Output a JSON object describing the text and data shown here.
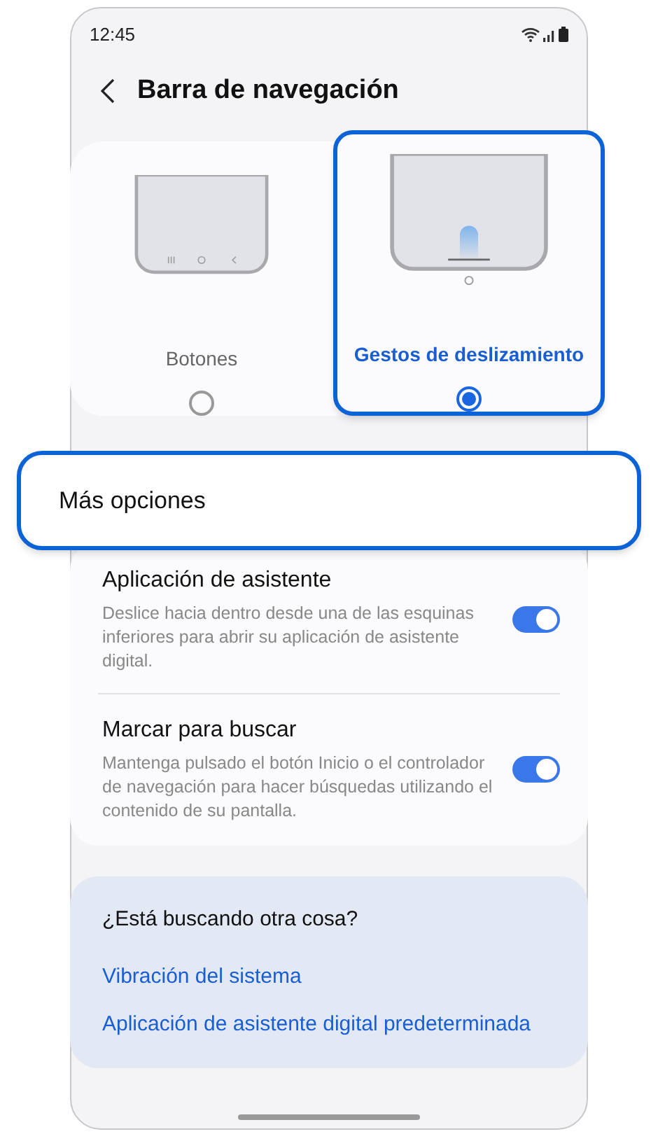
{
  "status_bar": {
    "time": "12:45"
  },
  "header": {
    "title": "Barra de navegación"
  },
  "nav_options": [
    {
      "kind": "buttons",
      "label": "Botones",
      "selected": false
    },
    {
      "kind": "gestures",
      "label": "Gestos de deslizamiento",
      "selected": true
    }
  ],
  "more_options": {
    "label": "Más opciones"
  },
  "settings": [
    {
      "title": "Aplicación de asistente",
      "description": "Deslice hacia dentro desde una de las esquinas inferiores para abrir su aplicación de asistente digital.",
      "on": true
    },
    {
      "title": "Marcar para buscar",
      "description": "Mantenga pulsado el botón Inicio o el controlador de navegación para hacer búsquedas utilizando el contenido de su pantalla.",
      "on": true
    }
  ],
  "suggestions": {
    "title": "¿Está buscando otra cosa?",
    "links": [
      "Vibración del sistema",
      "Aplicación de asistente digital predeterminada"
    ]
  }
}
